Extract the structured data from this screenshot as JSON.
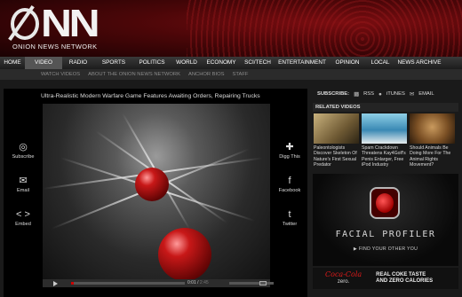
{
  "brand": {
    "wordmark": "NN",
    "name": "ONION NEWS NETWORK"
  },
  "nav": {
    "items": [
      "HOME",
      "VIDEO",
      "RADIO",
      "SPORTS",
      "POLITICS",
      "WORLD",
      "ECONOMY",
      "SCI/TECH",
      "ENTERTAINMENT",
      "OPINION",
      "LOCAL",
      "NEWS ARCHIVE"
    ],
    "active": "VIDEO"
  },
  "subnav": {
    "items": [
      "WATCH VIDEOS",
      "ABOUT THE ONION NEWS NETWORK",
      "ANCHOR BIOS",
      "STAFF"
    ]
  },
  "video": {
    "title": "Ultra-Realistic Modern Warfare Game Features Awaiting Orders, Repairing Trucks",
    "time_current": "0:01",
    "time_total": "2:45",
    "progress": 0.02
  },
  "side_actions_left": [
    {
      "label": "Subscribe",
      "icon": "subscribe-icon"
    },
    {
      "label": "Email",
      "icon": "email-icon"
    },
    {
      "label": "Embed",
      "icon": "embed-icon"
    }
  ],
  "side_actions_right": [
    {
      "label": "Digg This",
      "icon": "digg-icon"
    },
    {
      "label": "Facebook",
      "icon": "facebook-icon"
    },
    {
      "label": "Twitter",
      "icon": "twitter-icon"
    }
  ],
  "subscribe": {
    "label": "SUBSCRIBE:",
    "rss": "RSS",
    "itunes": "iTUNES",
    "email": "EMAIL"
  },
  "related": {
    "header": "RELATED VIDEOS",
    "items": [
      {
        "caption": "Paleontologists Discover Skeleton Of Nature's First Sexual Predator"
      },
      {
        "caption": "Spam Crackdown Threatens Kay4Golf's Penis Enlarger, Free iPod Industry"
      },
      {
        "caption": "Should Animals Be Doing More For The Animal Rights Movement?"
      }
    ]
  },
  "ad": {
    "title": "FACIAL PROFILER",
    "link": "▶ FIND YOUR OTHER YOU"
  },
  "coke": {
    "logo": "Coca-Cola",
    "zero": "zero.",
    "line1": "REAL COKE TASTE",
    "line2": "AND ZERO CALORIES"
  },
  "colors": {
    "brand_red": "#7a0d10",
    "progress": "#cc0000",
    "accent_text": "#dddddd"
  }
}
